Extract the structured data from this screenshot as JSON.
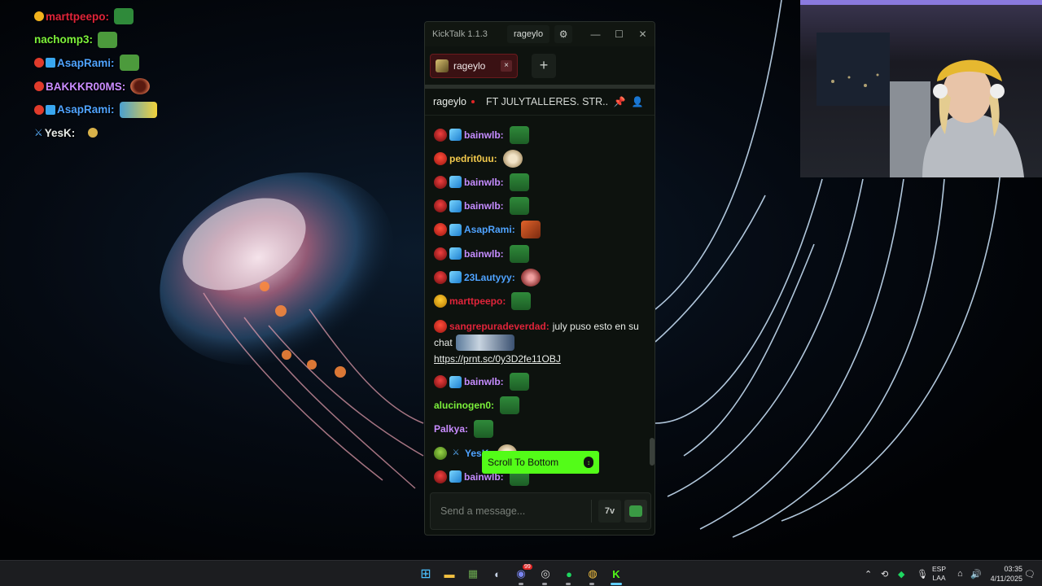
{
  "overlay_chat": [
    {
      "user": "marttpeepo:",
      "color": "#e0243a",
      "badges": [
        "gold"
      ],
      "emote": "frog"
    },
    {
      "user": "nachomp3:",
      "color": "#7cf23b",
      "badges": [],
      "emote": "frog"
    },
    {
      "user": "AsapRami:",
      "color": "#4fa3ff",
      "badges": [
        "sub",
        "cube"
      ],
      "emote": "frog"
    },
    {
      "user": "BAKKKR00MS:",
      "color": "#c98cff",
      "badges": [
        "sub"
      ],
      "emote": "face"
    },
    {
      "user": "AsapRami:",
      "color": "#4fa3ff",
      "badges": [
        "sub",
        "cube"
      ],
      "emote": "minion"
    },
    {
      "user": "YesK:",
      "color": "#e8ece8",
      "badges": [
        "sword"
      ],
      "emote": "small"
    }
  ],
  "window": {
    "title": "KickTalk 1.1.3",
    "user_chip": "rageylo",
    "settings_icon": "gear-icon",
    "minimize_icon": "minimize-icon",
    "maximize_icon": "maximize-icon",
    "close_icon": "close-icon"
  },
  "tabs": [
    {
      "label": "rageylo",
      "close": "×"
    }
  ],
  "add_tab": "+",
  "chat_header": {
    "channel": "rageylo",
    "stream_title": "FT JULYTALLERES. STR...",
    "icons": [
      "pin-icon",
      "user-icon"
    ]
  },
  "messages": [
    {
      "user": "bainwlb:",
      "color": "#c58cff",
      "badges": [
        "sub",
        "cube"
      ],
      "emote": "frog"
    },
    {
      "user": "pedrit0uu:",
      "color": "#f2c94c",
      "badges": [
        "sub2"
      ],
      "emote": "face"
    },
    {
      "user": "bainwlb:",
      "color": "#c58cff",
      "badges": [
        "sub",
        "cube"
      ],
      "emote": "frog"
    },
    {
      "user": "bainwlb:",
      "color": "#c58cff",
      "badges": [
        "sub",
        "cube"
      ],
      "emote": "frog"
    },
    {
      "user": "AsapRami:",
      "color": "#4fa3ff",
      "badges": [
        "sub2",
        "cube"
      ],
      "emote": "orange"
    },
    {
      "user": "bainwlb:",
      "color": "#c58cff",
      "badges": [
        "sub",
        "cube"
      ],
      "emote": "frog"
    },
    {
      "user": "23Lautyyy:",
      "color": "#4fa3ff",
      "badges": [
        "sub",
        "cube"
      ],
      "emote": "pink"
    },
    {
      "user": "marttpeepo:",
      "color": "#e0243a",
      "badges": [
        "gold"
      ],
      "emote": "frog"
    },
    {
      "user": "sangrepuradeverdad:",
      "color": "#e0243a",
      "badges": [
        "sub2"
      ],
      "text_before": "july puso esto en su chat",
      "link": "https://prnt.sc/0y3D2fe11OBJ"
    },
    {
      "user": "bainwlb:",
      "color": "#c58cff",
      "badges": [
        "sub",
        "cube"
      ],
      "emote": "frog"
    },
    {
      "user": "alucinogen0:",
      "color": "#7cf23b",
      "badges": [],
      "emote": "frog"
    },
    {
      "user": "Palkya:",
      "color": "#c98cff",
      "badges": [],
      "emote": "frog"
    },
    {
      "user": "YesK:",
      "color": "#4fa3ff",
      "badges": [
        "bot",
        "sword"
      ],
      "emote": "face"
    },
    {
      "user": "bainwlb:",
      "color": "#c58cff",
      "badges": [
        "sub",
        "cube"
      ],
      "emote": "frog"
    }
  ],
  "scroll_to_bottom": "Scroll To Bottom",
  "input": {
    "placeholder": "Send a message...",
    "seventv_button": "7v",
    "emote_button": "frog-emote-icon"
  },
  "taskbar": {
    "apps": [
      "windows-start-icon",
      "file-explorer-icon",
      "minecraft-icon",
      "steam-icon",
      "discord-icon",
      "obs-icon",
      "spotify-icon",
      "chrome-icon",
      "kick-icon"
    ],
    "discord_badge": "99",
    "language": "ESP",
    "layout": "LAA",
    "time": "03:35",
    "date": "4/11/2025"
  }
}
